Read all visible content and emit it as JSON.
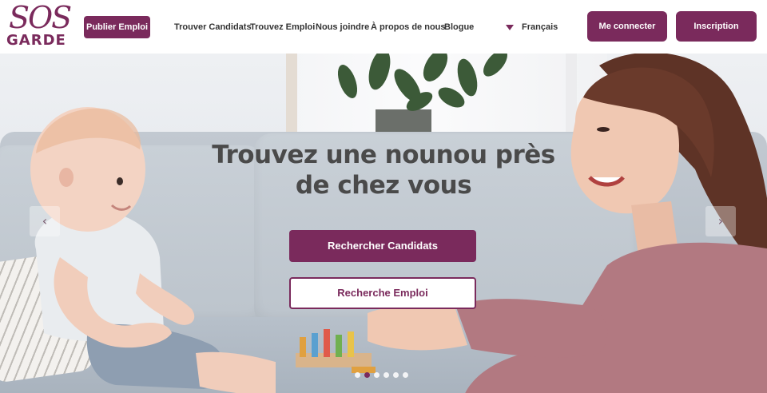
{
  "brand": {
    "logo_top": "SOS",
    "logo_bottom": "GARDE",
    "color": "#7a2a5c"
  },
  "nav": {
    "publish_label": "Publier Emploi",
    "links": [
      "Trouver Candidats",
      "Trouvez Emploi",
      "Nous joindre",
      "À propos de nous",
      "Blogue"
    ],
    "language": "Français",
    "login_label": "Me connecter",
    "signup_label": "Inscription"
  },
  "hero": {
    "title": "Trouvez une nounou près de chez vous",
    "search_candidates_label": "Rechercher Candidats",
    "search_job_label": "Recherche Emploi",
    "prev_arrow": "‹",
    "next_arrow": "›",
    "slide_count": 6,
    "active_slide": 2
  }
}
